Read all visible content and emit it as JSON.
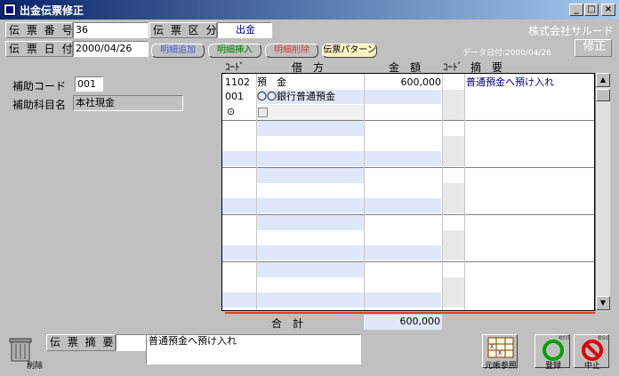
{
  "window": {
    "title": "出金伝票修正"
  },
  "header": {
    "slip_no_label": "伝 票 番 号",
    "slip_no": "36",
    "slip_type_label": "伝 票 区 分",
    "slip_type": "出金",
    "company": "株式会社サルード",
    "slip_date_label": "伝 票 日 付",
    "slip_date": "2000/04/26",
    "data_date": "データ日付:2000/04/26",
    "mode": "修正"
  },
  "toolbar": {
    "add_line": "明細追加",
    "insert_line": "明細挿入",
    "delete_line": "明細削除",
    "slip_pattern": "伝票パターン"
  },
  "side": {
    "sub_code_label": "補助コード",
    "sub_code": "001",
    "sub_name_label": "補助科目名",
    "sub_name": "本社現金"
  },
  "grid": {
    "col_code": "ｺｰﾄﾞ",
    "col_debit": "借　方",
    "col_amount": "金　額",
    "col_code2": "ｺｰﾄﾞ",
    "col_memo": "摘　要",
    "entry": {
      "code": "1102",
      "account": "預　金",
      "amount": "600,000",
      "memo": "普通預金へ預け入れ",
      "sub_code": "001",
      "sub_name": "〇〇銀行普通預金"
    },
    "total_label": "合　計",
    "total": "600,000"
  },
  "footer": {
    "delete_label": "削除",
    "memo_label": "伝 票 摘 要",
    "memo_code": "",
    "memo_text": "普通預金へ預け入れ",
    "ledger_label": "元帳参照",
    "register_label": "登録",
    "register_key": "ent",
    "cancel_label": "中止",
    "cancel_key": "esc"
  }
}
